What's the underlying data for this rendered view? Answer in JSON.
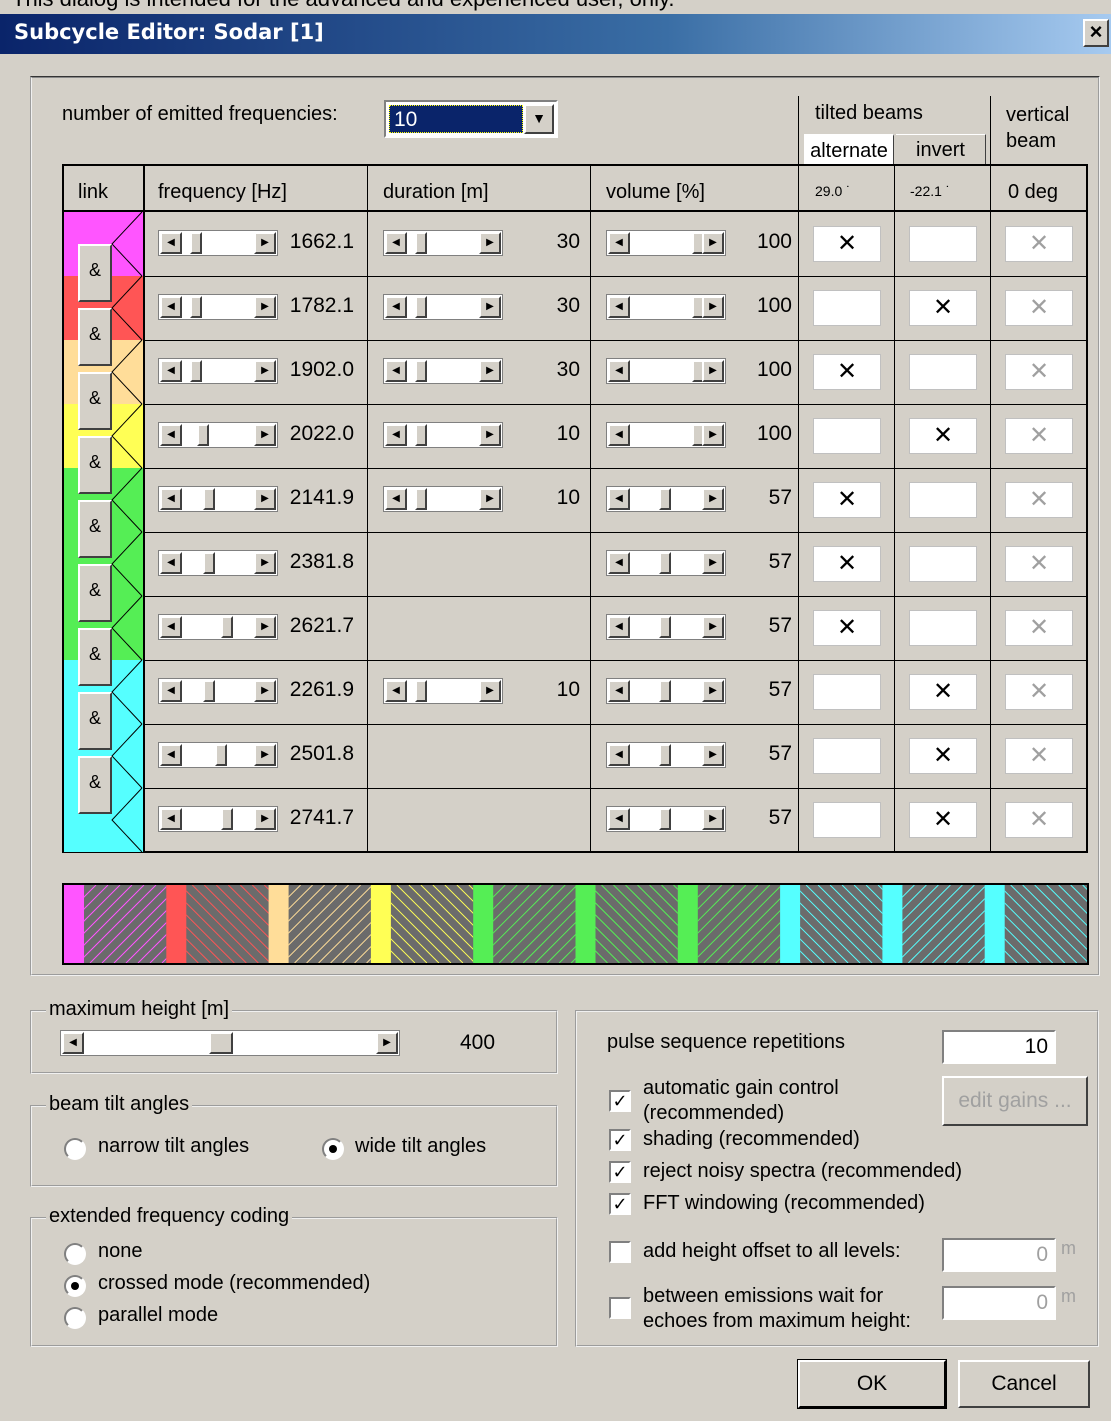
{
  "banner": "This dialog is intended for the advanced and experienced user, only.",
  "window": {
    "title": "Subcycle Editor: Sodar [1]",
    "close_icon": "close-icon"
  },
  "emitted": {
    "label": "number of emitted frequencies:",
    "value": "10"
  },
  "tilted_header": "tilted beams",
  "tab_alternate": "alternate",
  "tab_invert": "invert",
  "vertical_header": "vertical beam",
  "columns": {
    "link": "link",
    "frequency": "frequency [Hz]",
    "duration": "duration [m]",
    "volume": "volume [%]",
    "tilt1": "29.0 ˙",
    "tilt2": "-22.1 ˙",
    "vertical": "0 deg"
  },
  "rows": [
    {
      "frequency": "1662.1",
      "duration": "30",
      "volume": "100",
      "alt": "X",
      "inv": "",
      "vert": "X",
      "color": "#ff55ff",
      "freq_pos": 0.12,
      "dur_pos": 0.12,
      "vol_pos": 0.99
    },
    {
      "frequency": "1782.1",
      "duration": "30",
      "volume": "100",
      "alt": "",
      "inv": "X",
      "vert": "X",
      "color": "#ff5555",
      "freq_pos": 0.12,
      "dur_pos": 0.12,
      "vol_pos": 0.99
    },
    {
      "frequency": "1902.0",
      "duration": "30",
      "volume": "100",
      "alt": "X",
      "inv": "",
      "vert": "X",
      "color": "#ffdd99",
      "freq_pos": 0.12,
      "dur_pos": 0.12,
      "vol_pos": 0.99
    },
    {
      "frequency": "2022.0",
      "duration": "10",
      "volume": "100",
      "alt": "",
      "inv": "X",
      "vert": "X",
      "color": "#ffff55",
      "freq_pos": 0.22,
      "dur_pos": 0.12,
      "vol_pos": 0.99
    },
    {
      "frequency": "2141.9",
      "duration": "10",
      "volume": "57",
      "alt": "X",
      "inv": "",
      "vert": "X",
      "color": "#55ee55",
      "freq_pos": 0.32,
      "dur_pos": 0.12,
      "vol_pos": 0.45
    },
    {
      "frequency": "2381.8",
      "duration": "",
      "volume": "57",
      "alt": "X",
      "inv": "",
      "vert": "X",
      "color": "#55ee55",
      "freq_pos": 0.32,
      "dur_pos": null,
      "vol_pos": 0.45
    },
    {
      "frequency": "2621.7",
      "duration": "",
      "volume": "57",
      "alt": "X",
      "inv": "",
      "vert": "X",
      "color": "#55ee55",
      "freq_pos": 0.62,
      "dur_pos": null,
      "vol_pos": 0.45
    },
    {
      "frequency": "2261.9",
      "duration": "10",
      "volume": "57",
      "alt": "",
      "inv": "X",
      "vert": "X",
      "color": "#55ffff",
      "freq_pos": 0.32,
      "dur_pos": 0.12,
      "vol_pos": 0.45
    },
    {
      "frequency": "2501.8",
      "duration": "",
      "volume": "57",
      "alt": "",
      "inv": "X",
      "vert": "X",
      "color": "#55ffff",
      "freq_pos": 0.52,
      "dur_pos": null,
      "vol_pos": 0.45
    },
    {
      "frequency": "2741.7",
      "duration": "",
      "volume": "57",
      "alt": "",
      "inv": "X",
      "vert": "X",
      "color": "#55ffff",
      "freq_pos": 0.62,
      "dur_pos": null,
      "vol_pos": 0.45
    }
  ],
  "link_label": "&",
  "max_height": {
    "label": "maximum height [m]",
    "value": "400",
    "position": 0.46
  },
  "beam_tilt": {
    "label": "beam tilt angles",
    "narrow": "narrow tilt angles",
    "wide": "wide tilt angles",
    "selected": "wide"
  },
  "ext_coding": {
    "label": "extended frequency coding",
    "none": "none",
    "crossed": "crossed mode (recommended)",
    "parallel": "parallel mode",
    "selected": "crossed"
  },
  "pulse": {
    "label": "pulse sequence repetitions",
    "value": "10"
  },
  "agc": {
    "label_line1": "automatic gain control",
    "label_line2": "(recommended)",
    "checked": true
  },
  "edit_gains": "edit gains ...",
  "shading": {
    "label": "shading (recommended)",
    "checked": true
  },
  "reject": {
    "label": "reject noisy spectra (recommended)",
    "checked": true
  },
  "fft": {
    "label": "FFT windowing (recommended)",
    "checked": true
  },
  "height_offset": {
    "label": "add height offset to all levels:",
    "value": "0",
    "unit": "m",
    "checked": false
  },
  "wait": {
    "label_line1": "between emissions wait for",
    "label_line2": "echoes from maximum height:",
    "value": "0",
    "unit": "m",
    "checked": false
  },
  "ok": "OK",
  "cancel": "Cancel"
}
